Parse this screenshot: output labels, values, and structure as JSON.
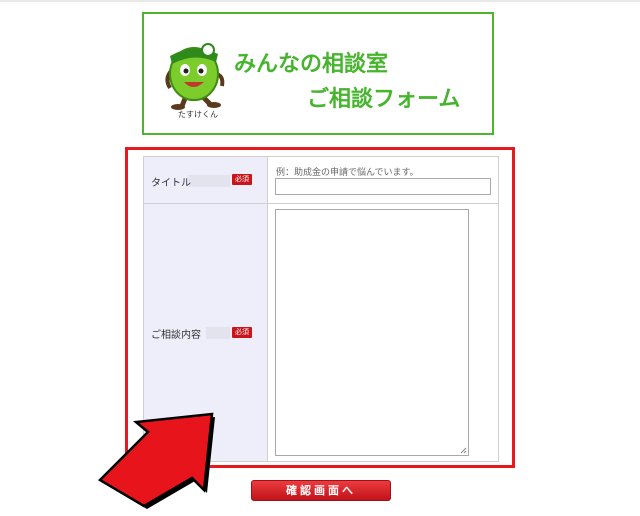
{
  "banner": {
    "title_line1": "みんなの相談室",
    "title_line2": "ご相談フォーム",
    "mascot_name": "たすけくん",
    "mascot_icon": "mascot-character",
    "accent_color": "#46b52d"
  },
  "form": {
    "title_row": {
      "label": "タイトル",
      "required_badge": "必須",
      "hint": "例：助成金の申請で悩んでいます。",
      "value": ""
    },
    "content_row": {
      "label": "ご相談内容",
      "required_badge": "必須",
      "value": ""
    }
  },
  "confirm_button": {
    "label": "確認画面へ"
  },
  "highlight": {
    "frame_color": "#e8191e",
    "arrow_icon": "red-pointer-arrow"
  }
}
